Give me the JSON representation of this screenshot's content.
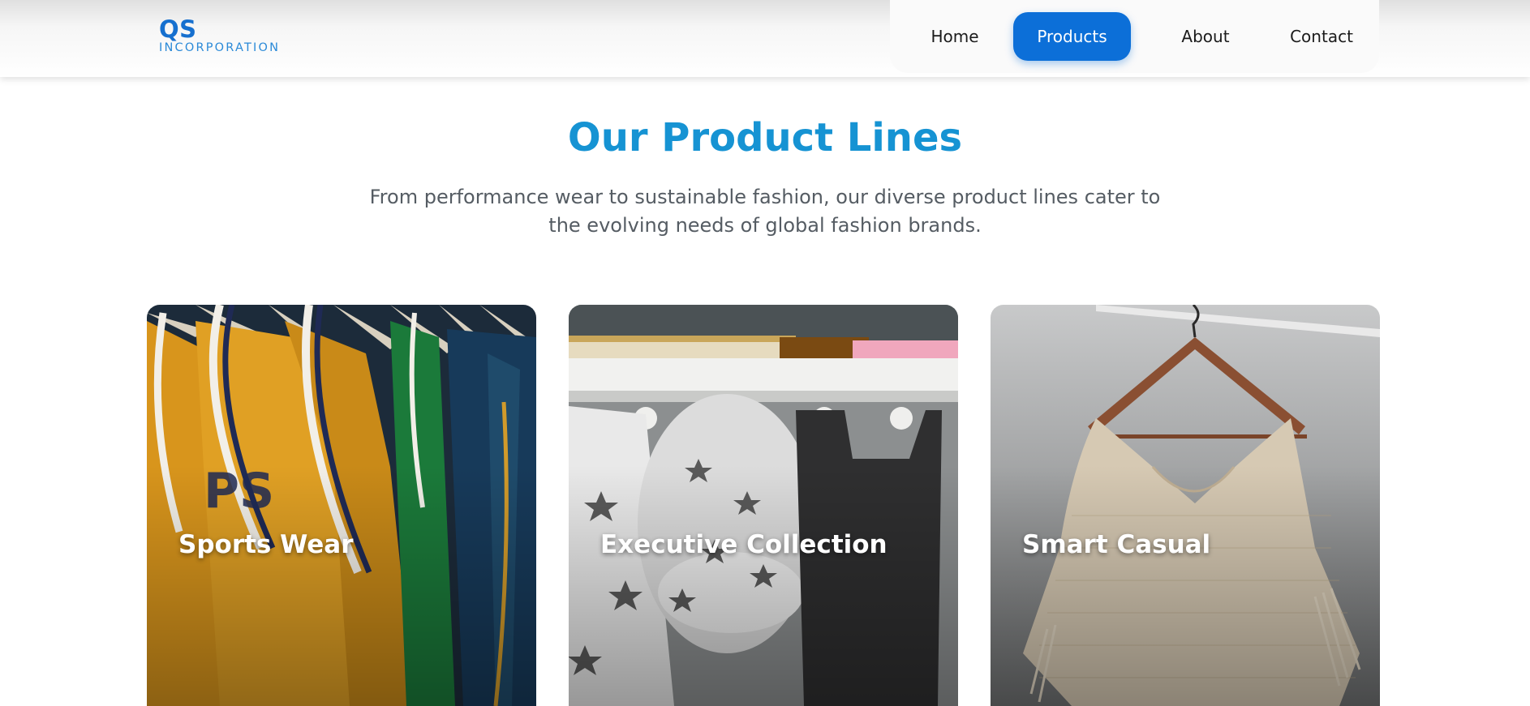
{
  "header": {
    "logo_mark": "QS",
    "logo_sub": "INCORPORATION",
    "nav": [
      {
        "label": "Home",
        "active": false
      },
      {
        "label": "Products",
        "active": true
      },
      {
        "label": "About",
        "active": false
      },
      {
        "label": "Contact",
        "active": false
      }
    ]
  },
  "section": {
    "title": "Our Product Lines",
    "description": "From performance wear to sustainable fashion, our diverse product lines cater to the evolving needs of global fashion brands."
  },
  "cards": [
    {
      "title": "Sports Wear",
      "image": "jerseys-on-hangers-photo"
    },
    {
      "title": "Executive Collection",
      "image": "star-print-clothes-on-hooks-photo"
    },
    {
      "title": "Smart Casual",
      "image": "knit-poncho-on-hanger-photo"
    }
  ],
  "colors": {
    "brand_blue": "#1670cf",
    "nav_active": "#0c6fd8",
    "title_blue": "#1693d3",
    "body_text": "#555c63"
  }
}
